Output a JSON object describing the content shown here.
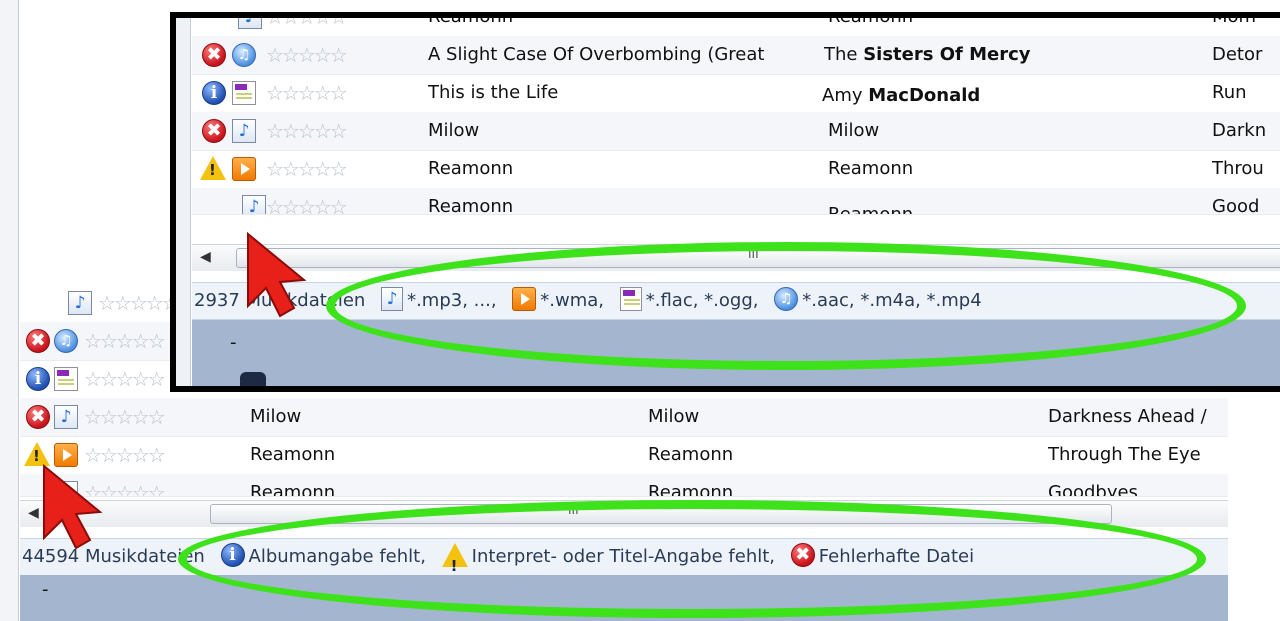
{
  "back": {
    "rows": [
      {
        "status": "",
        "type": "mp3",
        "title": "",
        "artist": "",
        "album": ""
      },
      {
        "status": "err",
        "type": "aac",
        "title": "",
        "artist": "",
        "album": ""
      },
      {
        "status": "info",
        "type": "flac",
        "title": "",
        "artist": "",
        "album": ""
      },
      {
        "status": "err",
        "type": "mp3",
        "title": "Milow",
        "artist": "Milow",
        "album": "Darkness Ahead /"
      },
      {
        "status": "warn",
        "type": "wma",
        "title": "Reamonn",
        "artist": "Reamonn",
        "album": "Through The Eye"
      },
      {
        "status": "",
        "type": "mp3",
        "title": "Reamonn",
        "artist": "Reamonn",
        "album": "Goodbyes"
      }
    ],
    "status_count": "44594 Musikdateien",
    "legend": [
      {
        "icon": "info",
        "label": "Albumangabe fehlt,"
      },
      {
        "icon": "warn",
        "label": "Interpret- oder Titel-Angabe fehlt,"
      },
      {
        "icon": "err",
        "label": "Fehlerhafte Datei"
      }
    ],
    "footer_text": "-",
    "scroll_grip": "III"
  },
  "front": {
    "rows": [
      {
        "status": "",
        "type": "mp3",
        "title": "Reamonn",
        "artist": "Reamonn",
        "album": "Mom"
      },
      {
        "status": "err",
        "type": "aac",
        "title": "A Slight Case Of Overbombing (Great",
        "artist_pre": "The ",
        "artist_bold": "Sisters Of Mercy",
        "album": "Detor"
      },
      {
        "status": "info",
        "type": "flac",
        "title": "This is the Life",
        "artist_pre": "Amy ",
        "artist_bold": "MacDonald",
        "album": "Run"
      },
      {
        "status": "err",
        "type": "mp3",
        "title": "Milow",
        "artist": "Milow",
        "album": "Darkn"
      },
      {
        "status": "warn",
        "type": "wma",
        "title": "Reamonn",
        "artist": "Reamonn",
        "album": "Throu"
      },
      {
        "status": "",
        "type": "mp3",
        "title": "Reamonn",
        "artist": "Reamonn",
        "album": "Good"
      }
    ],
    "status_count": "2937 Musikdateien",
    "legend": [
      {
        "icon": "mp3",
        "label": "*.mp3, ...,"
      },
      {
        "icon": "wma",
        "label": "*.wma,"
      },
      {
        "icon": "flac",
        "label": "*.flac, *.ogg,"
      },
      {
        "icon": "aac",
        "label": "*.aac, *.m4a, *.mp4"
      }
    ],
    "footer_text": "-",
    "scroll_grip": "III",
    "stars": "☆☆☆☆☆"
  },
  "colors": {
    "highlight": "#3ee21a",
    "pointer": "#e8201a",
    "frame": "#000000",
    "footer": "#a4b6cf"
  }
}
